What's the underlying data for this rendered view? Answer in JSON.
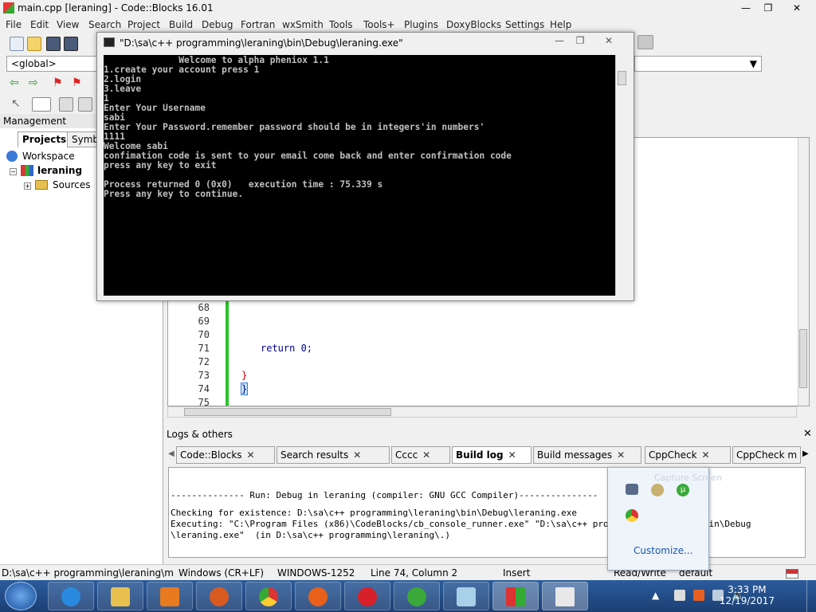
{
  "window": {
    "title": "main.cpp [leraning] - Code::Blocks 16.01"
  },
  "menu": [
    "File",
    "Edit",
    "View",
    "Search",
    "Project",
    "Build",
    "Debug",
    "Fortran",
    "wxSmith",
    "Tools",
    "Tools+",
    "Plugins",
    "DoxyBlocks",
    "Settings",
    "Help"
  ],
  "toolbar": {
    "scope_combo": "<global>"
  },
  "management": {
    "title": "Management",
    "tabs": [
      "Projects",
      "Symbo"
    ],
    "tree": {
      "workspace": "Workspace",
      "project": "leraning",
      "folder": "Sources"
    }
  },
  "editor": {
    "lines": [
      {
        "num": "68",
        "code": ""
      },
      {
        "num": "69",
        "code": ""
      },
      {
        "num": "70",
        "code": ""
      },
      {
        "num": "71",
        "code": "return 0;"
      },
      {
        "num": "72",
        "code": ""
      },
      {
        "num": "73",
        "code": "}"
      },
      {
        "num": "74",
        "code": "}"
      },
      {
        "num": "75",
        "code": ""
      }
    ]
  },
  "console": {
    "title": "\"D:\\sa\\c++ programming\\leraning\\bin\\Debug\\leraning.exe\"",
    "output": "              Welcome to alpha pheniox 1.1\n1.create your account press 1\n2.login\n3.leave\n1\nEnter Your Username\nsabi\nEnter Your Password.remember password should be in integers'in numbers'\n1111\nWelcome sabi\nconfimation code is sent to your email come back and enter confirmation code\npress any key to exit\n\nProcess returned 0 (0x0)   execution time : 75.339 s\nPress any key to continue."
  },
  "logs": {
    "title": "Logs & others",
    "tabs": [
      "Code::Blocks",
      "Search results",
      "Cccc",
      "Build log",
      "Build messages",
      "CppCheck",
      "CppCheck m"
    ],
    "lines": [
      "-------------- Run: Debug in leraning (compiler: GNU GCC Compiler)---------------",
      "Checking for existence: D:\\sa\\c++ programming\\leraning\\bin\\Debug\\leraning.exe",
      "Executing: \"C:\\Program Files (x86)\\CodeBlocks/cb_console_runner.exe\" \"D:\\sa\\c++ programming\\leraning\\bin\\Debug",
      "\\leraning.exe\"  (in D:\\sa\\c++ programming\\leraning\\.)"
    ]
  },
  "tray_popup": {
    "customize": "Customize...",
    "ghost": "Capture Screen"
  },
  "statusbar": {
    "path": "D:\\sa\\c++ programming\\leraning\\main.c",
    "eol": "Windows (CR+LF)",
    "encoding": "WINDOWS-1252",
    "position": "Line 74, Column 2",
    "mode": "Insert",
    "access": "Read/Write",
    "profile": "default"
  },
  "taskbar": {
    "time": "3:33 PM",
    "date": "12/19/2017"
  },
  "colors": {
    "console_bg": "#000000",
    "console_fg": "#c0c0c0",
    "taskbar": "#1f4478",
    "change_bar": "#29c329"
  }
}
